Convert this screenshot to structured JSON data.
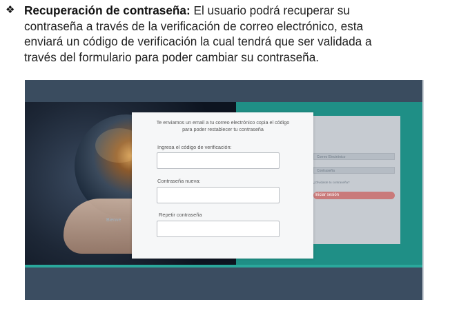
{
  "paragraph": {
    "bullet": "❖",
    "term": "Recuperación de contraseña:",
    "line1_rest": " El usuario podrá recuperar su",
    "line2": "contraseña a través de la verificación de correo electrónico, esta",
    "line3": "enviará un código de verificación la cual tendrá que ser validada a",
    "line4": "través del formulario para poder cambiar su contraseña."
  },
  "screenshot": {
    "globe_caption": "Bienve",
    "carousel_dots": "●●●",
    "modal": {
      "message_line1": "Te enviamos un email a tu correo electrónico copia el código",
      "message_line2": "para poder restablecer tu contraseña",
      "code_label": "Ingresa el código de verificación:",
      "new_password_label": "Contraseña nueva:",
      "repeat_password_label": "Repetir contraseña",
      "code_value": "",
      "new_password_value": "",
      "repeat_password_value": ""
    },
    "background_form": {
      "email_placeholder": "Correo Electrónico",
      "password_placeholder": "Contraseña",
      "small_text": "¿Olvidaste tu contraseña?",
      "login_button": "Iniciar sesión"
    }
  },
  "colors": {
    "teal": "#1f8f86",
    "dark_blue": "#3b4f62",
    "button_red": "#c97a7a"
  }
}
